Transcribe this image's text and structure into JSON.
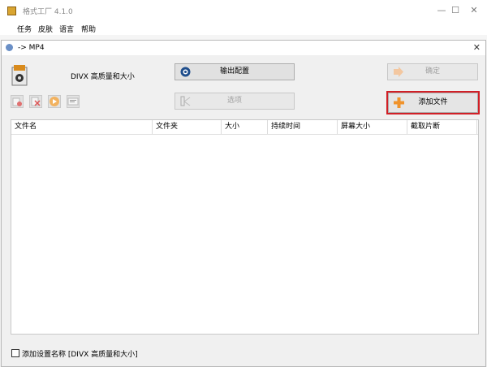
{
  "app": {
    "title": "格式工厂 4.1.0",
    "menu": [
      "任务",
      "皮肤",
      "语言",
      "帮助"
    ],
    "window_controls": [
      "—",
      "☐",
      "✕"
    ]
  },
  "dialog": {
    "title": "-> MP4",
    "close": "✕",
    "profile_label": "DIVX 高质量和大小",
    "buttons": {
      "output_config": "输出配置",
      "ok": "确定",
      "options": "选项",
      "add_file": "添加文件"
    },
    "table": {
      "columns": [
        "文件名",
        "文件夹",
        "大小",
        "持续时间",
        "屏幕大小",
        "截取片断"
      ]
    },
    "footer": {
      "checkbox_label": "添加设置名称 [DIVX 高质量和大小]",
      "checked": false
    }
  },
  "colors": {
    "highlight": "#d11f26",
    "accent_orange": "#f0932b"
  }
}
